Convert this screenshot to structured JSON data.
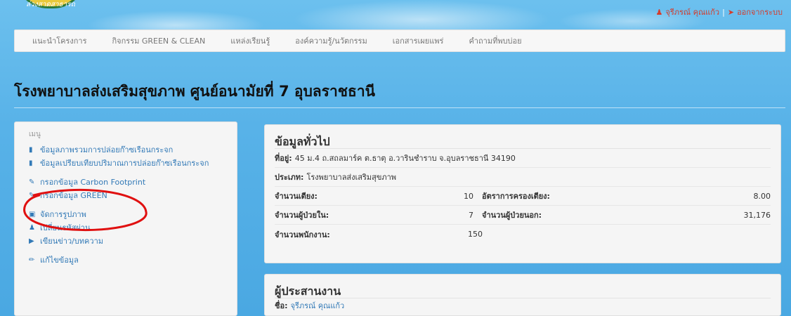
{
  "header": {
    "logo_text": "ล่วงสาดสาธารณ",
    "user_name": "จุรีภรณ์ คุณแก้ว",
    "separator": "|",
    "logout_label": "ออกจากระบบ"
  },
  "navbar": {
    "items": [
      {
        "label": "แนะนำโครงการ"
      },
      {
        "label": "กิจกรรม GREEN & CLEAN"
      },
      {
        "label": "แหล่งเรียนรู้"
      },
      {
        "label": "องค์ความรู้/นวัตกรรม"
      },
      {
        "label": "เอกสารเผยแพร่"
      },
      {
        "label": "คำถามที่พบบ่อย"
      }
    ]
  },
  "page": {
    "title": "โรงพยาบาลส่งเสริมสุขภาพ ศูนย์อนามัยที่ 7 อุบลราชธานี"
  },
  "sidebar": {
    "heading": "เมนู",
    "items": [
      {
        "label": "ข้อมูลภาพรวมการปล่อยก๊าซเรือนกระจก",
        "icon": "file-icon"
      },
      {
        "label": "ข้อมูลเปรียบเทียบปริมาณการปล่อยก๊าซเรือนกระจก",
        "icon": "file-icon"
      },
      {
        "label": "กรอกข้อมูล Carbon Footprint",
        "icon": "edit-icon"
      },
      {
        "label": "กรอกข้อมูล GREEN",
        "icon": "edit-icon"
      },
      {
        "label": "จัดการรูปภาพ",
        "icon": "image-icon"
      },
      {
        "label": "เปลี่ยนรหัสผ่าน",
        "icon": "user-icon"
      },
      {
        "label": "เขียนข่าว/บทความ",
        "icon": "bullhorn-icon"
      },
      {
        "label": "แก้ไขข้อมูล",
        "icon": "pencil-icon"
      }
    ]
  },
  "general_info": {
    "title": "ข้อมูลทั่วไป",
    "address_label": "ที่อยู่:",
    "address_value": "45 ม.4 ถ.สถลมาร์ค ต.ธาตุ อ.วารินชำราบ จ.อุบลราชธานี 34190",
    "type_label": "ประเภท:",
    "type_value": "โรงพยาบาลส่งเสริมสุขภาพ",
    "beds_label": "จำนวนเตียง:",
    "beds_value": "10",
    "occupancy_label": "อัตราการครองเตียง:",
    "occupancy_value": "8.00",
    "inpatients_label": "จำนวนผู้ป่วยใน:",
    "inpatients_value": "7",
    "outpatients_label": "จำนวนผู้ป่วยนอก:",
    "outpatients_value": "31,176",
    "staff_label": "จำนวนพนักงาน:",
    "staff_value": "150"
  },
  "coordinator": {
    "title": "ผู้ประสานงาน",
    "name_label": "ชื่อ:",
    "name_value": "จุรีภรณ์ คุณแก้ว"
  },
  "colors": {
    "link": "#337ab7",
    "annotation": "#e01010",
    "logout": "#d43c2c"
  }
}
